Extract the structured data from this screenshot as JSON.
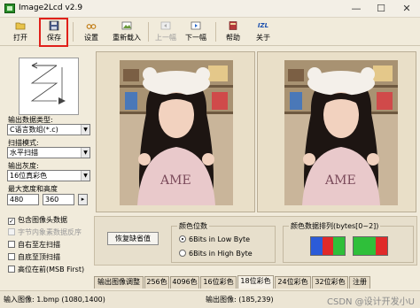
{
  "window": {
    "title": "Image2Lcd v2.9",
    "minimize": "—",
    "maximize": "☐",
    "close": "✕"
  },
  "toolbar": {
    "open": "打开",
    "save": "保存",
    "settings": "设置",
    "reload": "重新载入",
    "prev": "上一幅",
    "next": "下一幅",
    "help": "帮助",
    "about": "关于",
    "about_icon_text": "IZL"
  },
  "left_panel": {
    "output_type_label": "输出数据类型:",
    "output_type_value": "C语言数组(*.c)",
    "scan_mode_label": "扫描模式:",
    "scan_mode_value": "水平扫描",
    "gray_label": "输出灰度:",
    "gray_value": "16位真彩色",
    "max_size_label": "最大宽度和高度",
    "max_width": "480",
    "max_height": "360",
    "size_btn": "▸",
    "checkboxes": [
      {
        "label": "包含图像头数据",
        "checked": true,
        "enabled": true
      },
      {
        "label": "字节内象素数据反序",
        "checked": false,
        "enabled": false
      },
      {
        "label": "自右至左扫描",
        "checked": false,
        "enabled": true
      },
      {
        "label": "自底至顶扫描",
        "checked": false,
        "enabled": true
      },
      {
        "label": "高位在前(MSB First)",
        "checked": false,
        "enabled": true
      }
    ]
  },
  "bottom": {
    "restore_defaults": "恢复缺省值",
    "color_bits_title": "颜色位数",
    "radio_low": "6Bits in Low Byte",
    "radio_high": "6Bits in High Byte",
    "color_order_title": "颜色数据排列(bytes[0~2])"
  },
  "tabs": [
    "输出图像调整",
    "256色",
    "4096色",
    "16位彩色",
    "18位彩色",
    "24位彩色",
    "32位彩色",
    "注册"
  ],
  "active_tab": 4,
  "status": {
    "input_image": "输入图像: 1.bmp (1080,1400)",
    "output_image": "输出图像: (185,239)",
    "watermark": "CSDN @设计开发小U"
  },
  "colors": {
    "red_highlight": "#e0201a",
    "swatch_blue": "#2b5bd8",
    "swatch_red": "#e02a2a",
    "swatch_green": "#2fbf3a"
  }
}
